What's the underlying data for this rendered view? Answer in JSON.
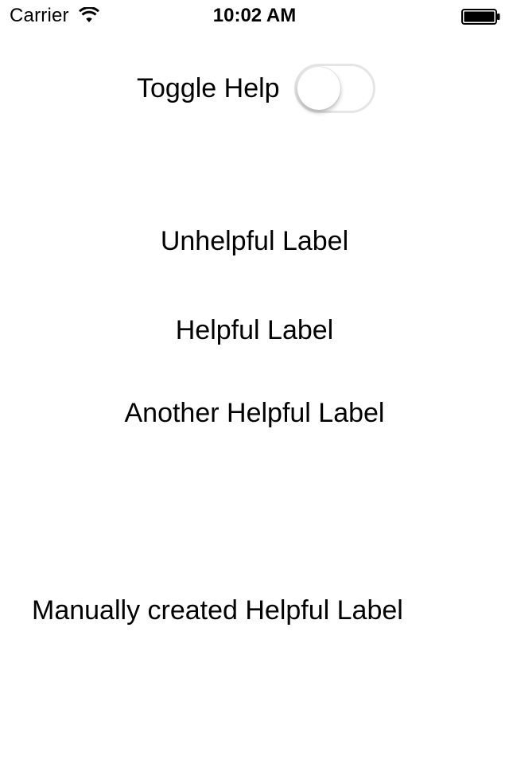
{
  "status_bar": {
    "carrier": "Carrier",
    "time": "10:02 AM",
    "wifi_icon": "wifi-icon",
    "battery_icon": "battery-icon",
    "battery_level": 1.0
  },
  "help_toggle": {
    "label": "Toggle Help",
    "is_on": false,
    "track_border_color": "#e5e5e5",
    "knob_color": "#ffffff"
  },
  "labels": {
    "unhelpful": "Unhelpful Label",
    "helpful": "Helpful Label",
    "another_helpful": "Another Helpful Label",
    "manual_helpful": "Manually created Helpful Label"
  },
  "colors": {
    "background": "#ffffff",
    "text": "#000000"
  }
}
